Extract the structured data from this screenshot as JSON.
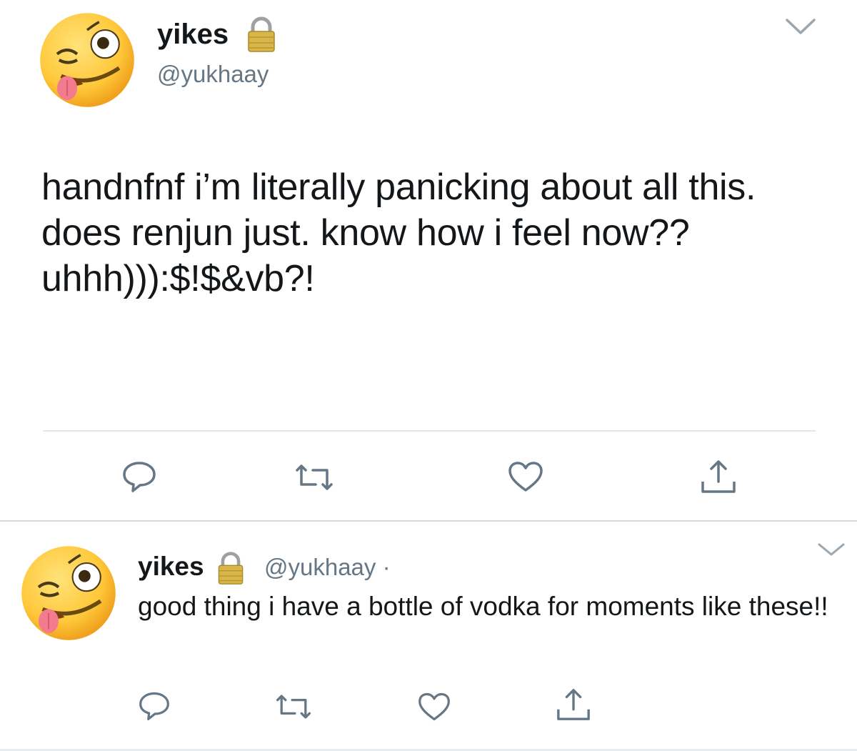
{
  "colors": {
    "text": "#14171a",
    "secondary": "#657786",
    "icon": "#657786",
    "divider": "#e1e8ed"
  },
  "main_tweet": {
    "display_name": "yikes",
    "handle": "@yukhaay",
    "text": "handnfnf i’m literally panicking about all this. does renjun just. know how i feel now?? uhhh))):$!$&vb?!",
    "avatar_icon": "zany-face-emoji",
    "lock_icon": "lock-icon",
    "actions": [
      "reply-icon",
      "retweet-icon",
      "like-icon",
      "share-icon"
    ]
  },
  "reply_tweet": {
    "display_name": "yikes",
    "handle": "@yukhaay ·",
    "text": "good thing i have a bottle of vodka for moments like these!!",
    "avatar_icon": "zany-face-emoji",
    "lock_icon": "lock-icon",
    "actions": [
      "reply-icon",
      "retweet-icon",
      "like-icon",
      "share-icon"
    ]
  }
}
